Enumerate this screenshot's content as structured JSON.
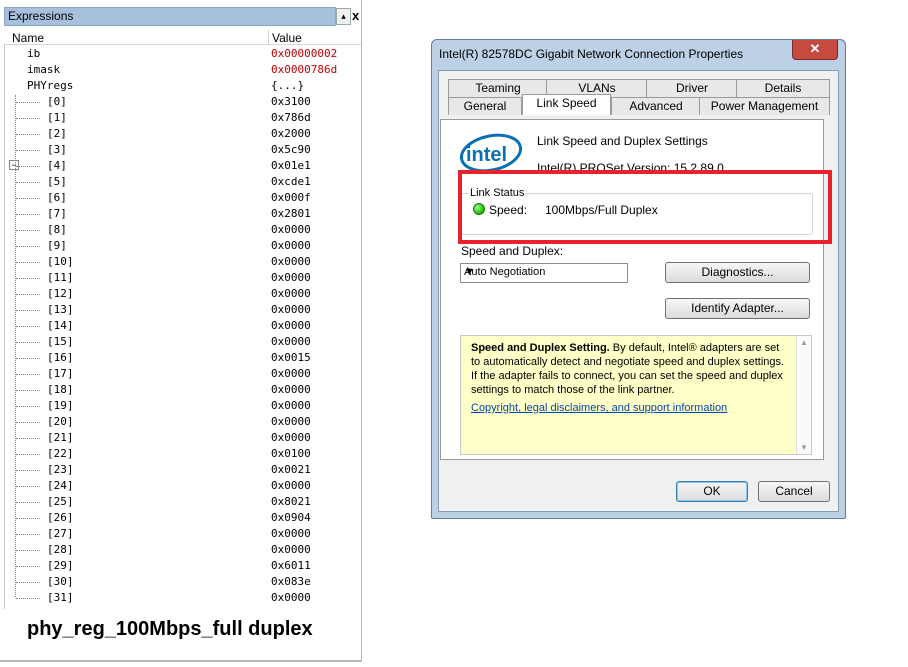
{
  "expressions": {
    "title": "Expressions",
    "pin_glyph": "▴",
    "close_glyph": "x",
    "columns": {
      "name": "Name",
      "value": "Value"
    },
    "expander_glyph": "−",
    "top_rows": [
      {
        "name": "ib",
        "value": "0x00000002"
      },
      {
        "name": "imask",
        "value": "0x0000786d"
      },
      {
        "name": "PHYregs",
        "value": "{...}"
      }
    ],
    "phy_rows": [
      {
        "name": "[0]",
        "value": "0x3100"
      },
      {
        "name": "[1]",
        "value": "0x786d"
      },
      {
        "name": "[2]",
        "value": "0x2000"
      },
      {
        "name": "[3]",
        "value": "0x5c90"
      },
      {
        "name": "[4]",
        "value": "0x01e1"
      },
      {
        "name": "[5]",
        "value": "0xcde1"
      },
      {
        "name": "[6]",
        "value": "0x000f"
      },
      {
        "name": "[7]",
        "value": "0x2801"
      },
      {
        "name": "[8]",
        "value": "0x0000"
      },
      {
        "name": "[9]",
        "value": "0x0000"
      },
      {
        "name": "[10]",
        "value": "0x0000"
      },
      {
        "name": "[11]",
        "value": "0x0000"
      },
      {
        "name": "[12]",
        "value": "0x0000"
      },
      {
        "name": "[13]",
        "value": "0x0000"
      },
      {
        "name": "[14]",
        "value": "0x0000"
      },
      {
        "name": "[15]",
        "value": "0x0000"
      },
      {
        "name": "[16]",
        "value": "0x0015"
      },
      {
        "name": "[17]",
        "value": "0x0000"
      },
      {
        "name": "[18]",
        "value": "0x0000"
      },
      {
        "name": "[19]",
        "value": "0x0000"
      },
      {
        "name": "[20]",
        "value": "0x0000"
      },
      {
        "name": "[21]",
        "value": "0x0000"
      },
      {
        "name": "[22]",
        "value": "0x0100"
      },
      {
        "name": "[23]",
        "value": "0x0021"
      },
      {
        "name": "[24]",
        "value": "0x0000"
      },
      {
        "name": "[25]",
        "value": "0x8021"
      },
      {
        "name": "[26]",
        "value": "0x0904"
      },
      {
        "name": "[27]",
        "value": "0x0000"
      },
      {
        "name": "[28]",
        "value": "0x0000"
      },
      {
        "name": "[29]",
        "value": "0x6011"
      },
      {
        "name": "[30]",
        "value": "0x083e"
      },
      {
        "name": "[31]",
        "value": "0x0000"
      }
    ],
    "caption": "phy_reg_100Mbps_full duplex"
  },
  "dialog": {
    "title": "Intel(R) 82578DC Gigabit Network Connection Properties",
    "close_glyph": "✕",
    "tabs_back": [
      "Teaming",
      "VLANs",
      "Driver",
      "Details"
    ],
    "tabs_front": [
      "General",
      "Link Speed",
      "Advanced",
      "Power Management"
    ],
    "logo_text": "intel",
    "header_title": "Link Speed and Duplex Settings",
    "header_version": "Intel(R) PROSet Version: 15.2.89.0",
    "link_status": {
      "label": "Link Status",
      "speed_label": "Speed:",
      "speed_value": "100Mbps/Full Duplex",
      "led_color": "#17b500"
    },
    "speed_duplex_label": "Speed and Duplex:",
    "speed_duplex_value": "Auto Negotiation",
    "dropdown_glyph": "▼",
    "diagnostics_button": "Diagnostics...",
    "identify_button": "Identify Adapter...",
    "help": {
      "bold": "Speed and Duplex Setting.",
      "text": " By default, Intel® adapters are set to automatically detect and negotiate speed and duplex settings. If the adapter fails to connect, you can set the speed and duplex settings to match those of the link partner.",
      "link": "Copyright, legal disclaimers, and support information"
    },
    "ok_button": "OK",
    "cancel_button": "Cancel",
    "highlight_color": "#e8222b"
  }
}
